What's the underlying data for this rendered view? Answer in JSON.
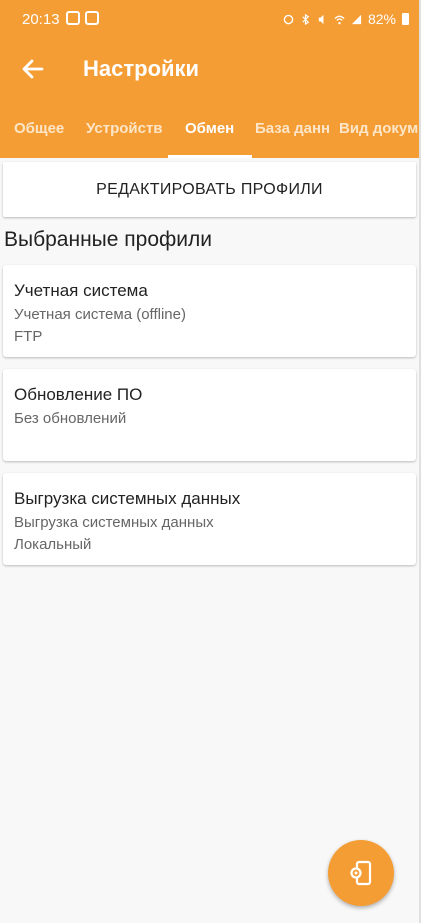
{
  "status_bar": {
    "time": "20:13",
    "battery": "82%"
  },
  "header": {
    "title": "Настройки"
  },
  "tabs": [
    {
      "label": "Общее",
      "active": false
    },
    {
      "label": "Устройств",
      "active": false
    },
    {
      "label": "Обмен",
      "active": true
    },
    {
      "label": "База данн",
      "active": false
    },
    {
      "label": "Вид докум",
      "active": false
    }
  ],
  "edit_button": {
    "label": "РЕДАКТИРОВАТЬ ПРОФИЛИ"
  },
  "section": {
    "title": "Выбранные профили"
  },
  "profiles": [
    {
      "title": "Учетная система",
      "subtitle": "Учетная система (offline)",
      "detail": "FTP"
    },
    {
      "title": "Обновление ПО",
      "subtitle": "Без обновлений",
      "detail": ""
    },
    {
      "title": "Выгрузка системных данных",
      "subtitle": "Выгрузка системных данных",
      "detail": "Локальный"
    }
  ],
  "colors": {
    "accent": "#f59d35"
  },
  "icons": {
    "back": "arrow-left-icon",
    "fab": "device-settings-icon"
  }
}
